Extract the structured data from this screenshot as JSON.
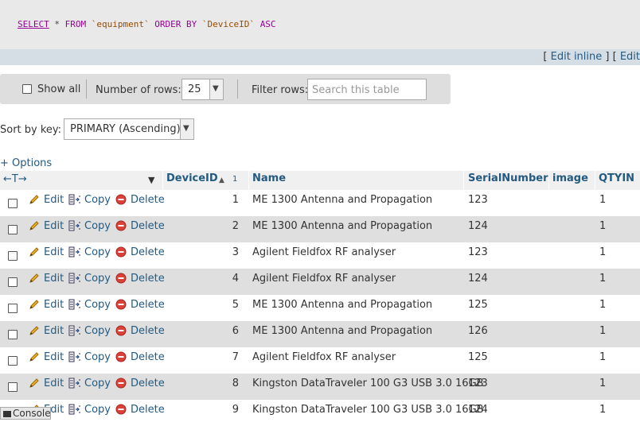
{
  "sql": {
    "select": "SELECT",
    "star": " * ",
    "from": "FROM",
    "table": " `equipment` ",
    "orderby": "ORDER BY",
    "column": " `DeviceID` ",
    "asc": "ASC"
  },
  "edit_links": {
    "open1": "[ ",
    "edit_inline": "Edit inline",
    "close1": " ] [ ",
    "edit": "Edit"
  },
  "nav": {
    "show_all": "Show all",
    "num_rows_label": "Number of rows:",
    "num_rows_value": "25",
    "filter_label": "Filter rows:",
    "search_placeholder": "Search this table"
  },
  "sort": {
    "label": "Sort by key:",
    "value": "PRIMARY (Ascending)"
  },
  "options_link": "+ Options",
  "columns": {
    "arrows": "←T→",
    "device_id": "DeviceID",
    "sort_order": "1",
    "name": "Name",
    "serial": "SerialNumber",
    "image": "image",
    "qtyin": "QTYIN"
  },
  "actions": {
    "edit": "Edit",
    "copy": "Copy",
    "delete": "Delete"
  },
  "rows": [
    {
      "id": "1",
      "name": "ME 1300 Antenna and Propagation",
      "serial": "123",
      "qty": "1"
    },
    {
      "id": "2",
      "name": "ME 1300 Antenna and Propagation",
      "serial": "124",
      "qty": "1"
    },
    {
      "id": "3",
      "name": "Agilent Fieldfox RF analyser",
      "serial": "123",
      "qty": "1"
    },
    {
      "id": "4",
      "name": "Agilent Fieldfox RF analyser",
      "serial": "124",
      "qty": "1"
    },
    {
      "id": "5",
      "name": "ME 1300 Antenna and Propagation",
      "serial": "125",
      "qty": "1"
    },
    {
      "id": "6",
      "name": "ME 1300 Antenna and Propagation",
      "serial": "126",
      "qty": "1"
    },
    {
      "id": "7",
      "name": "Agilent Fieldfox RF analyser",
      "serial": "125",
      "qty": "1"
    },
    {
      "id": "8",
      "name": "Kingston DataTraveler 100 G3 USB 3.0 16GB",
      "serial": "123",
      "qty": "1"
    },
    {
      "id": "9",
      "name": "Kingston DataTraveler 100 G3 USB 3.0 16GB",
      "serial": "124",
      "qty": "1"
    }
  ],
  "console": "Console"
}
